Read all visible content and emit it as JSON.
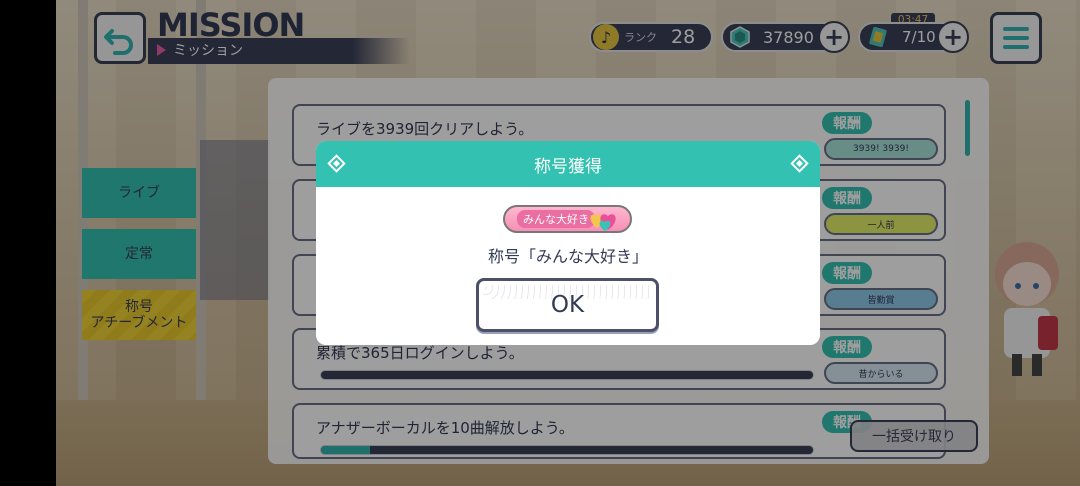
{
  "header": {
    "title": "MISSION",
    "subtitle": "ミッション",
    "rank_label": "ランク",
    "rank_value": "28",
    "crystal_value": "37890",
    "live_value": "7/10",
    "timer": "03:47",
    "plus": "+"
  },
  "tabs": [
    {
      "label": "ライブ"
    },
    {
      "label": "定常"
    },
    {
      "label": "称号\nアチーブメント"
    }
  ],
  "missions": [
    {
      "text": "ライブを3939回クリアしよう。",
      "reward_label": "報酬",
      "reward_text": "3939! 3939!",
      "progress": null
    },
    {
      "text": "",
      "reward_label": "報酬",
      "reward_text": "一人前",
      "progress": null
    },
    {
      "text": "",
      "reward_label": "報酬",
      "reward_text": "皆勤賞",
      "progress": null
    },
    {
      "text": "累積で365日ログインしよう。",
      "reward_label": "報酬",
      "reward_text": "昔からいる",
      "progress": 0.0
    },
    {
      "text": "アナザーボーカルを10曲解放しよう。",
      "reward_label": "報酬",
      "reward_text": "",
      "progress": 0.1
    }
  ],
  "bulk_button": "一括受け取り",
  "modal": {
    "title": "称号獲得",
    "badge_text": "みんな大好き",
    "name_text": "称号「みんな大好き」",
    "ok_label": "OK"
  },
  "colors": {
    "accent": "#33c1b1",
    "navy": "#3b4058",
    "tab_yellow": "#f0d438",
    "badge_pink": "#f78fb6"
  }
}
